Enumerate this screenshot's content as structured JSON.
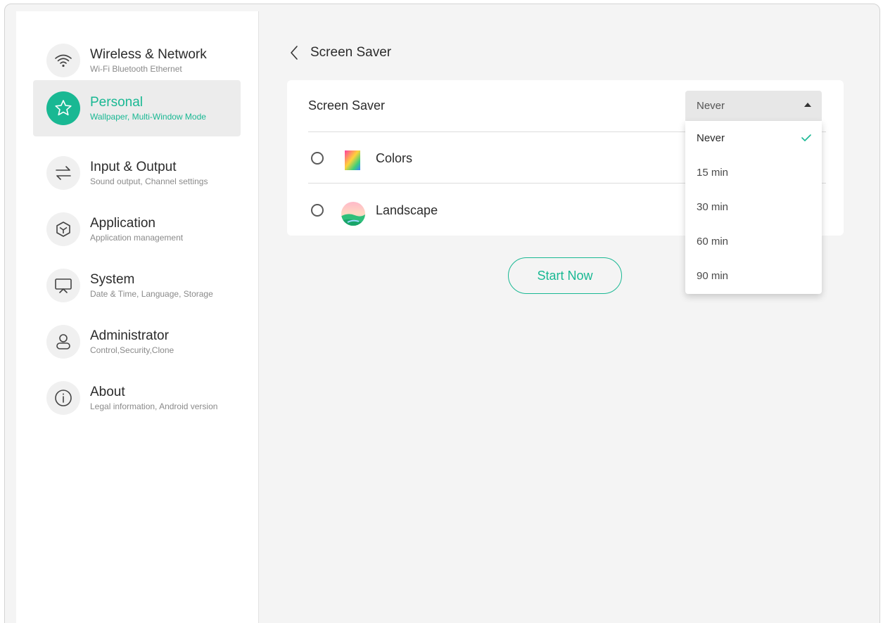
{
  "sidebar": {
    "items": [
      {
        "title": "Wireless & Network",
        "subtitle": "Wi-Fi Bluetooth Ethernet",
        "icon": "wifi-icon"
      },
      {
        "title": "Personal",
        "subtitle": "Wallpaper, Multi-Window Mode",
        "icon": "star-icon",
        "active": true
      },
      {
        "title": "Input & Output",
        "subtitle": "Sound output, Channel settings",
        "icon": "swap-arrows-icon"
      },
      {
        "title": "Application",
        "subtitle": "Application management",
        "icon": "cube-icon"
      },
      {
        "title": "System",
        "subtitle": "Date & Time, Language, Storage",
        "icon": "monitor-icon"
      },
      {
        "title": "Administrator",
        "subtitle": "Control,Security,Clone",
        "icon": "person-icon"
      },
      {
        "title": "About",
        "subtitle": "Legal information, Android version",
        "icon": "info-icon"
      }
    ]
  },
  "header": {
    "title": "Screen Saver",
    "back_icon": "chevron-left-icon"
  },
  "settings": {
    "row_label": "Screen Saver",
    "select": {
      "value": "Never"
    },
    "options": [
      {
        "label": "Colors",
        "icon": "colors-thumbnail-icon"
      },
      {
        "label": "Landscape",
        "icon": "landscape-thumbnail-icon"
      }
    ]
  },
  "dropdown": {
    "items": [
      "Never",
      "15 min",
      "30 min",
      "60 min",
      "90 min"
    ],
    "selected": "Never"
  },
  "actions": {
    "start_label": "Start Now"
  },
  "colors": {
    "accent": "#19b893",
    "background": "#f4f4f4"
  }
}
